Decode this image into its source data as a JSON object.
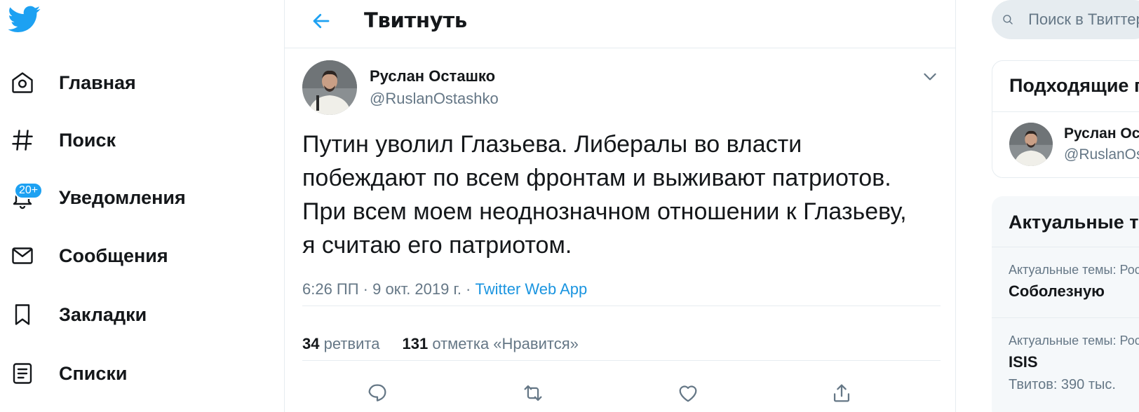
{
  "nav": {
    "items": [
      {
        "label": "Главная",
        "icon": "home-icon"
      },
      {
        "label": "Поиск",
        "icon": "hashtag-icon"
      },
      {
        "label": "Уведомления",
        "icon": "bell-icon",
        "badge": "20+"
      },
      {
        "label": "Сообщения",
        "icon": "envelope-icon"
      },
      {
        "label": "Закладки",
        "icon": "bookmark-icon"
      },
      {
        "label": "Списки",
        "icon": "list-icon"
      }
    ]
  },
  "header": {
    "title": "Твитнуть"
  },
  "tweet": {
    "author_name": "Руслан Осташко",
    "author_handle": "@RuslanOstashko",
    "text": "Путин уволил Глазьева. Либералы во власти побеждают по всем фронтам и выживают патриотов. При всем моем неоднозначном отношении к Глазьеву, я считаю его патриотом.",
    "time": "6:26 ПП · 9 окт. 2019 г. · ",
    "source": "Twitter Web App",
    "retweets_count": "34",
    "retweets_label": "ретвита",
    "likes_count": "131",
    "likes_label": "отметка «Нравится»"
  },
  "right": {
    "search_placeholder": "Поиск в Твиттере",
    "related_title": "Подходящие пользователи",
    "related_user": {
      "name": "Руслан Осташко",
      "handle": "@RuslanOstashko"
    },
    "trends_title": "Актуальные темы",
    "trends": [
      {
        "context": "Актуальные темы: Россия",
        "name": "Соболезную",
        "count": ""
      },
      {
        "context": "Актуальные темы: Россия",
        "name": "ISIS",
        "count": "Твитов: 390 тыс."
      }
    ]
  },
  "colors": {
    "accent": "#1da1f2",
    "link": "#1b95e0",
    "muted": "#657786",
    "border": "#e6ecf0"
  }
}
